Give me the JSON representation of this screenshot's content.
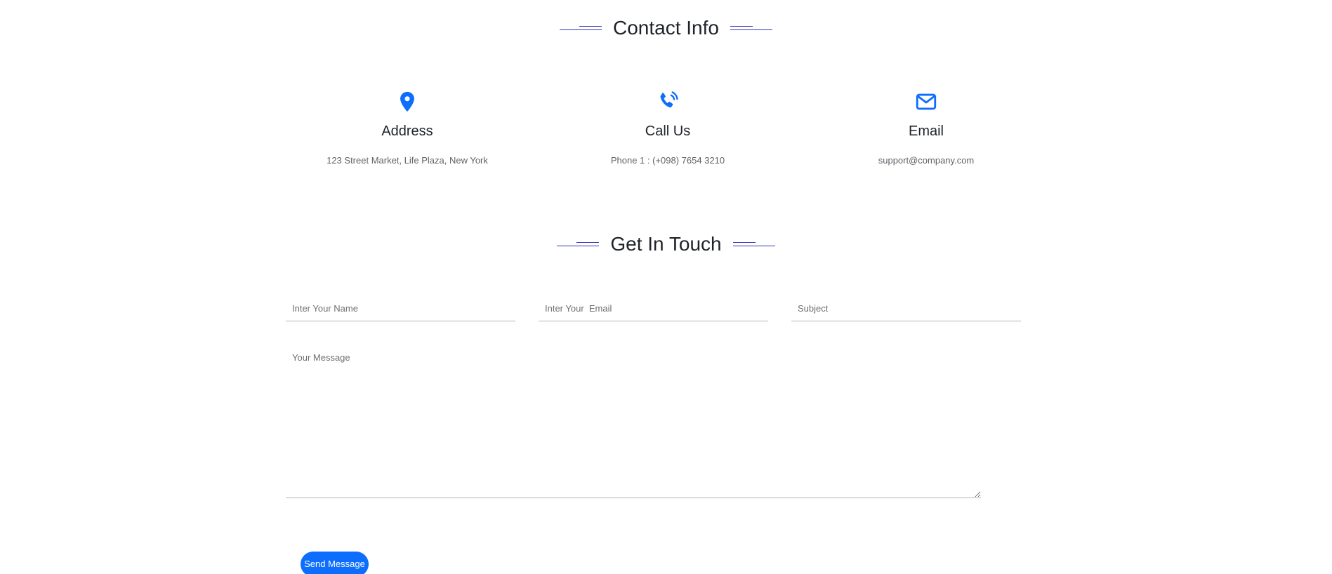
{
  "colors": {
    "accent": "#0d6efd",
    "heading_line": "#3535b8",
    "heading_text": "#1f2329",
    "muted_text": "#5f6368"
  },
  "contact_info": {
    "heading": "Contact Info",
    "cards": [
      {
        "icon": "map-pin-icon",
        "title": "Address",
        "text": "123 Street Market, Life Plaza, New York"
      },
      {
        "icon": "phone-ringing-icon",
        "title": "Call Us",
        "text": "Phone 1 : (+098) 7654 3210"
      },
      {
        "icon": "envelope-icon",
        "title": "Email",
        "text": "support@company.com"
      }
    ]
  },
  "get_in_touch": {
    "heading": "Get In Touch",
    "form": {
      "name_placeholder": "Inter Your Name",
      "email_placeholder": "Inter Your  Email",
      "subject_placeholder": "Subject",
      "message_placeholder": "Your Message",
      "name_value": "",
      "email_value": "",
      "subject_value": "",
      "message_value": "",
      "submit_label": "Send Message"
    }
  }
}
